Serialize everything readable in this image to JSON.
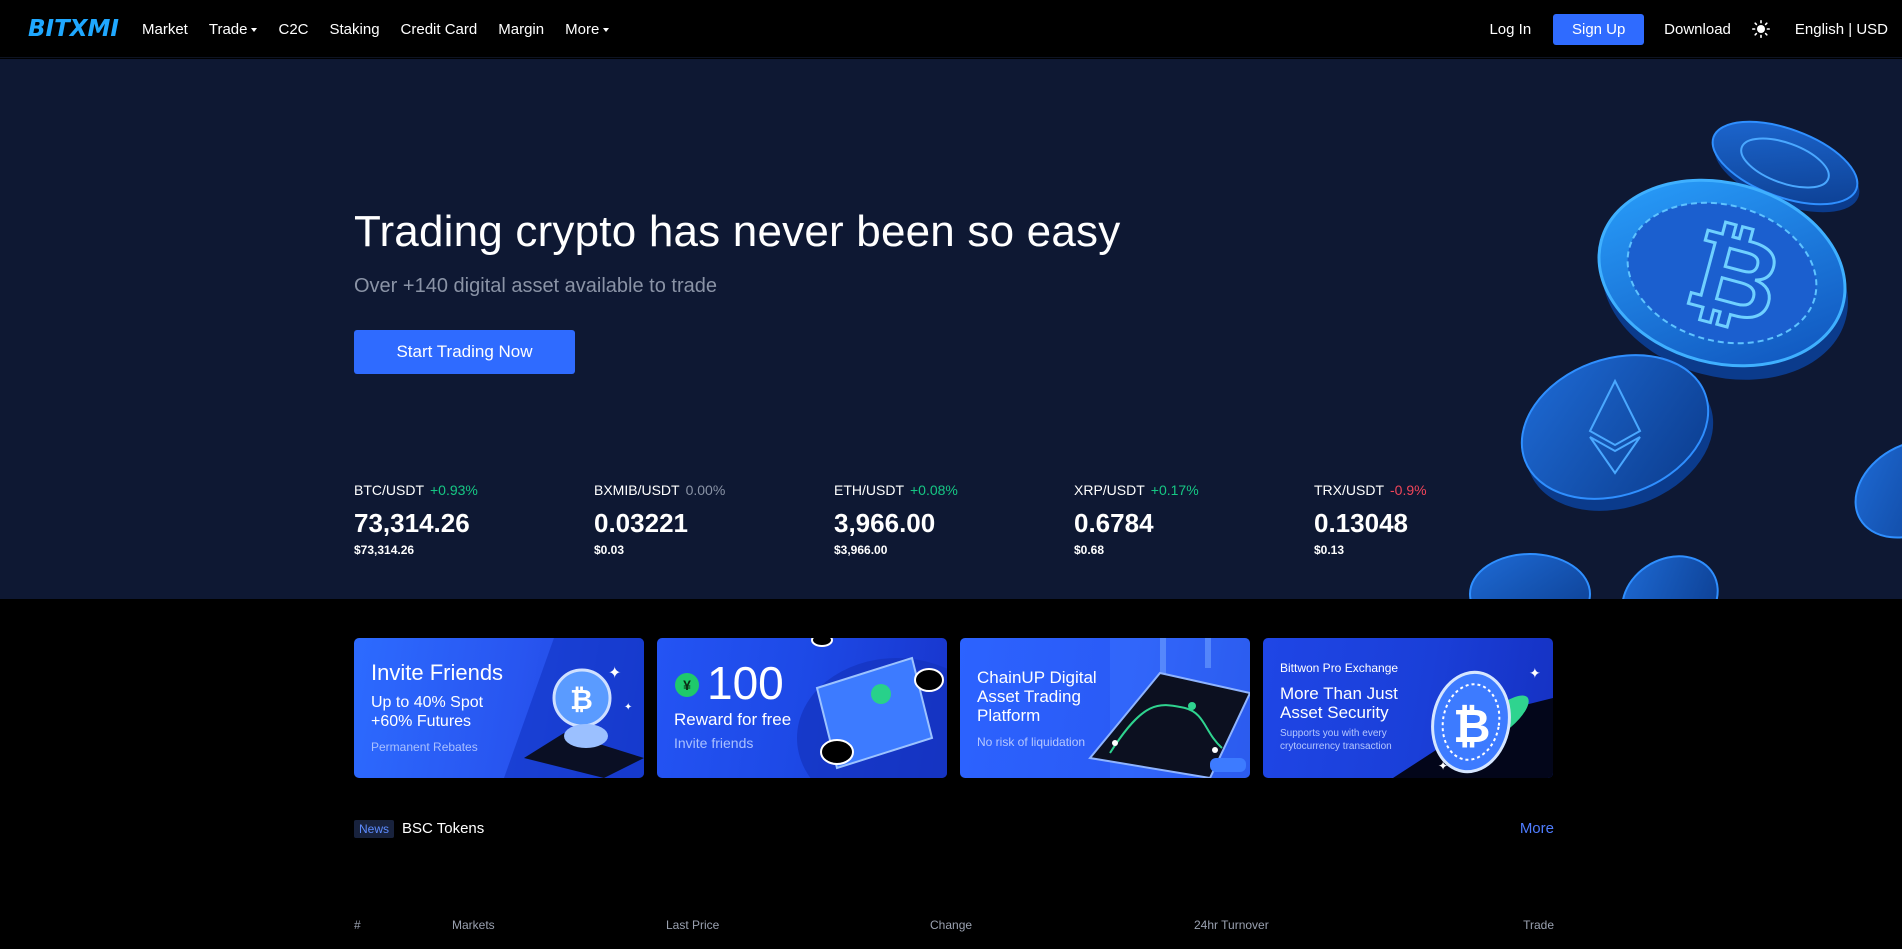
{
  "nav": {
    "logo": "BITXMI",
    "links": [
      "Market",
      "Trade",
      "C2C",
      "Staking",
      "Credit Card",
      "Margin",
      "More"
    ],
    "login": "Log In",
    "signup": "Sign Up",
    "download": "Download",
    "language": "English | USD"
  },
  "hero": {
    "title": "Trading crypto has never been so easy",
    "subtitle": "Over +140 digital asset available to trade",
    "cta": "Start Trading Now"
  },
  "tickers": [
    {
      "pair": "BTC/USDT",
      "change": "+0.93%",
      "price": "73,314.26",
      "usd": "$73,314.26",
      "color": "#16c784"
    },
    {
      "pair": "BXMIB/USDT",
      "change": "0.00%",
      "price": "0.03221",
      "usd": "$0.03",
      "color": "#8a93a6"
    },
    {
      "pair": "ETH/USDT",
      "change": "+0.08%",
      "price": "3,966.00",
      "usd": "$3,966.00",
      "color": "#16c784"
    },
    {
      "pair": "XRP/USDT",
      "change": "+0.17%",
      "price": "0.6784",
      "usd": "$0.68",
      "color": "#16c784"
    },
    {
      "pair": "TRX/USDT",
      "change": "-0.9%",
      "price": "0.13048",
      "usd": "$0.13",
      "color": "#f0455a"
    }
  ],
  "banners": {
    "invite": {
      "title": "Invite Friends",
      "line1": "Up to 40% Spot",
      "line2": "+60% Futures",
      "note": "Permanent Rebates"
    },
    "reward": {
      "amount": "100",
      "line1": "Reward for free",
      "note": "Invite friends",
      "currency_symbol": "¥"
    },
    "chainup": {
      "line1": "ChainUP Digital",
      "line2": "Asset Trading",
      "line3": "Platform",
      "note": "No risk of liquidation"
    },
    "bittwon": {
      "top": "Bittwon Pro Exchange",
      "line1": "More Than Just",
      "line2": "Asset Security",
      "note1": "Supports you with every",
      "note2": "crytocurrency transaction"
    }
  },
  "news": {
    "tag": "News",
    "title": "BSC Tokens",
    "more": "More"
  },
  "table": {
    "headers": [
      "#",
      "Markets",
      "Last Price",
      "Change",
      "24hr Turnover",
      "Trade"
    ]
  },
  "colors": {
    "accent": "#2f6bff",
    "hero_bg": "#0e1833",
    "up": "#16c784",
    "down": "#f0455a"
  }
}
